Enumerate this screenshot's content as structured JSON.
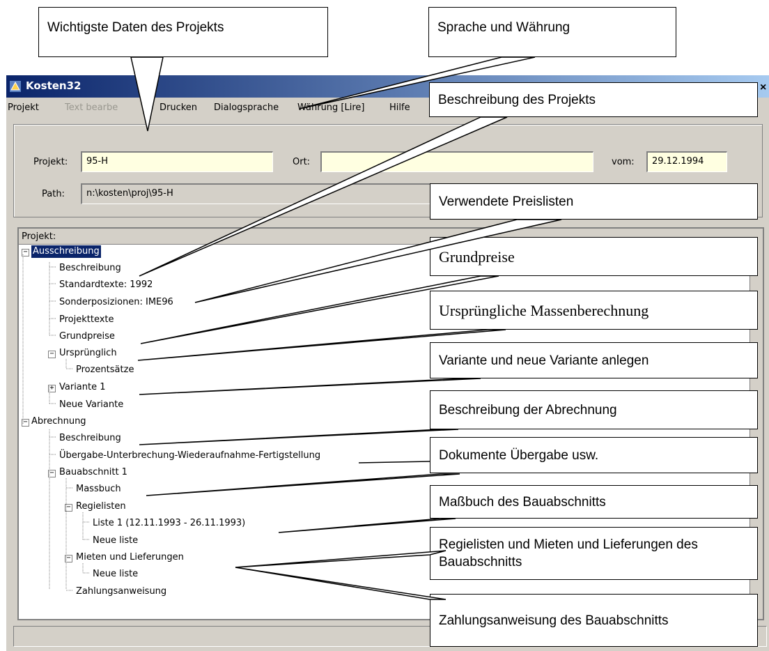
{
  "window": {
    "title": "Kosten32",
    "close": "×"
  },
  "menu": [
    {
      "label": "Projekt",
      "disabled": false
    },
    {
      "label": "Text bearbe",
      "disabled": true
    },
    {
      "label": "Drucken",
      "disabled": false
    },
    {
      "label": "Dialogsprache",
      "disabled": false
    },
    {
      "label": "Währung [Lire]",
      "disabled": false
    },
    {
      "label": "Hilfe",
      "disabled": false
    }
  ],
  "form": {
    "projekt_label": "Projekt:",
    "projekt_value": "95-H",
    "ort_label": "Ort:",
    "ort_value": "",
    "vom_label": "vom:",
    "vom_value": "29.12.1994",
    "path_label": "Path:",
    "path_value": "n:\\kosten\\proj\\95-H"
  },
  "tree": {
    "header": "Projekt:",
    "nodes": [
      {
        "label": "Ausschreibung",
        "sign": "−"
      },
      {
        "label": "Beschreibung"
      },
      {
        "label": "Standardtexte: 1992"
      },
      {
        "label": "Sonderposizionen: IME96"
      },
      {
        "label": "Projekttexte"
      },
      {
        "label": "Grundpreise"
      },
      {
        "label": "Ursprünglich",
        "sign": "−"
      },
      {
        "label": "Prozentsätze"
      },
      {
        "label": "Variante 1",
        "sign": "+"
      },
      {
        "label": "Neue Variante"
      },
      {
        "label": "Abrechnung",
        "sign": "−"
      },
      {
        "label": "Beschreibung"
      },
      {
        "label": "Übergabe-Unterbrechung-Wiederaufnahme-Fertigstellung"
      },
      {
        "label": "Bauabschnitt 1",
        "sign": "−"
      },
      {
        "label": "Massbuch"
      },
      {
        "label": "Regielisten",
        "sign": "−"
      },
      {
        "label": "Liste 1 (12.11.1993 - 26.11.1993)"
      },
      {
        "label": "Neue liste"
      },
      {
        "label": "Mieten und Lieferungen",
        "sign": "−"
      },
      {
        "label": "Neue liste"
      },
      {
        "label": "Zahlungsanweisung"
      }
    ]
  },
  "callouts": [
    {
      "text": "Wichtigste Daten des Projekts"
    },
    {
      "text": "Sprache und Währung"
    },
    {
      "text": "Beschreibung des Projekts"
    },
    {
      "text": "Verwendete Preislisten"
    },
    {
      "text": "Grundpreise"
    },
    {
      "text": "Ursprüngliche Massenberechnung"
    },
    {
      "text": "Variante und neue Variante anlegen"
    },
    {
      "text": "Beschreibung der Abrechnung"
    },
    {
      "text": "Dokumente Übergabe usw."
    },
    {
      "text": "Maßbuch des Bauabschnitts"
    },
    {
      "text": "Regielisten und Mieten und Lieferungen des Bauabschnitts"
    },
    {
      "text": "Zahlungsanweisung des Bauabschnitts"
    }
  ],
  "colors": {
    "selection": "#0a246a",
    "field_bg": "#ffffe1",
    "window_bg": "#d4d0c8"
  }
}
